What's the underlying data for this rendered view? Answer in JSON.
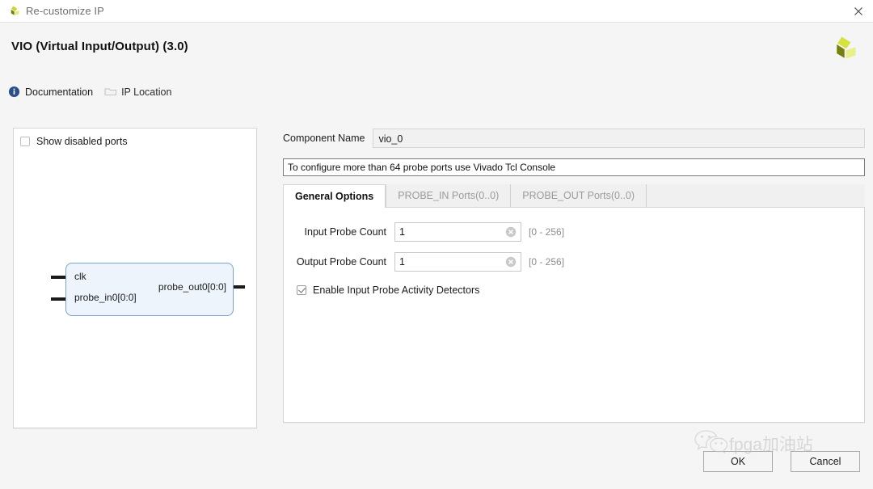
{
  "window": {
    "title": "Re-customize IP",
    "logo_icon": "xilinx-logo-icon",
    "close_icon": "close-icon"
  },
  "header": {
    "page_title": "VIO (Virtual Input/Output) (3.0)",
    "brand_logo_icon": "xilinx-logo-icon",
    "links": [
      {
        "label": "Documentation",
        "icon": "info-icon"
      },
      {
        "label": "IP Location",
        "icon": "folder-icon"
      }
    ]
  },
  "left_panel": {
    "show_disabled_ports": {
      "label": "Show disabled ports",
      "checked": false
    },
    "diagram": {
      "inputs": [
        "clk",
        "probe_in0[0:0]"
      ],
      "outputs": [
        "probe_out0[0:0]"
      ]
    }
  },
  "right_panel": {
    "component_name": {
      "label": "Component Name",
      "value": "vio_0"
    },
    "info_bar": "To configure more than 64 probe ports use Vivado Tcl Console",
    "tabs": [
      {
        "label": "General Options",
        "active": true
      },
      {
        "label": "PROBE_IN Ports(0..0)",
        "active": false
      },
      {
        "label": "PROBE_OUT Ports(0..0)",
        "active": false
      }
    ],
    "fields": [
      {
        "label": "Input  Probe  Count",
        "value": "1",
        "range": "[0 - 256]",
        "clear_icon": "clear-circle-icon"
      },
      {
        "label": "Output Probe Count",
        "value": "1",
        "range": "[0 - 256]",
        "clear_icon": "clear-circle-icon"
      }
    ],
    "enable_detectors": {
      "label": "Enable Input Probe Activity Detectors",
      "checked": true
    }
  },
  "footer": {
    "ok_label": "OK",
    "cancel_label": "Cancel"
  },
  "watermark": {
    "text": "fpga加油站",
    "icon": "wechat-icon"
  },
  "colors": {
    "window_bg": "#f5f5f5",
    "panel_bg": "#ffffff",
    "block_fill": "#eef4fb",
    "block_border": "#7aa2cc",
    "accent_blue": "#2b4f8a",
    "logo_green": "#c8d635",
    "logo_olive": "#77800f",
    "muted_text": "#9b9b9b"
  }
}
